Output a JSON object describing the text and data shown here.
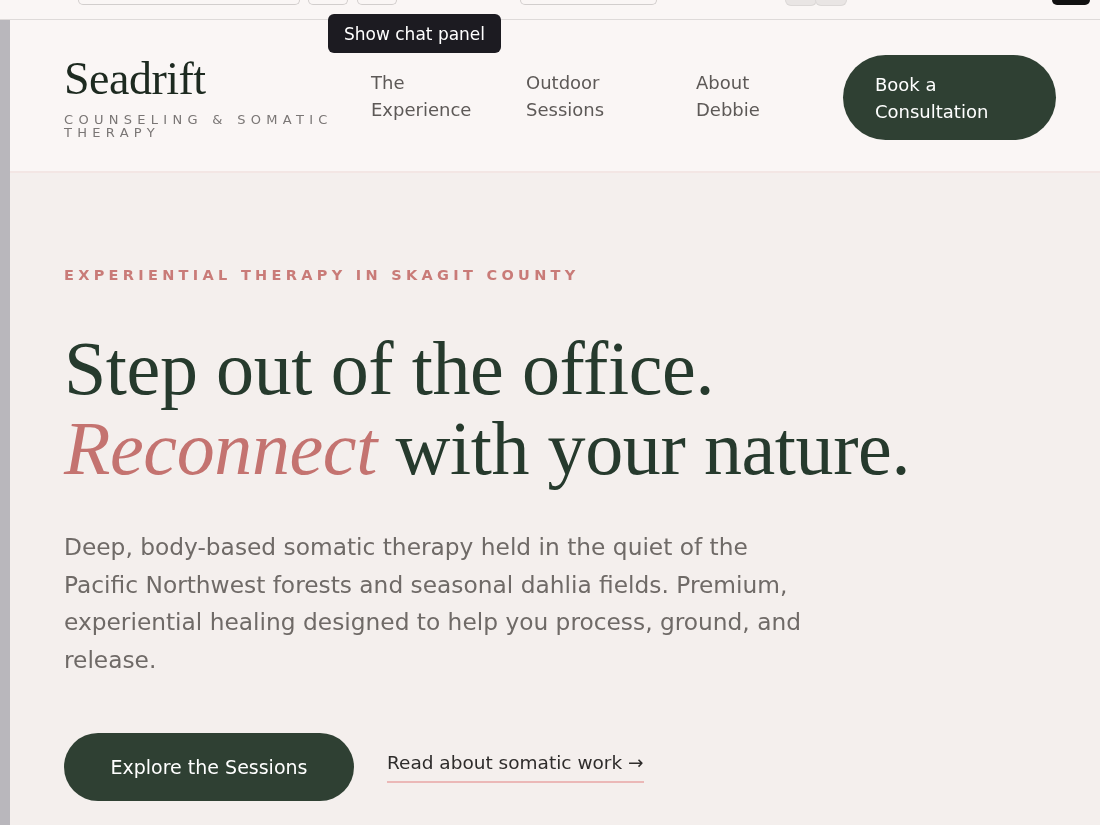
{
  "tooltip": {
    "text": "Show chat panel"
  },
  "header": {
    "logo": {
      "name": "Seadrift",
      "tagline": "COUNSELING & SOMATIC THERAPY"
    },
    "nav": [
      {
        "label": "The Experience"
      },
      {
        "label": "Outdoor Sessions"
      },
      {
        "label": "About Debbie"
      }
    ],
    "cta": "Book a Consultation"
  },
  "hero": {
    "eyebrow": "EXPERIENTIAL THERAPY IN SKAGIT COUNTY",
    "headline_lines": [
      "Step out of the office.",
      "*Reconnect* with your nature."
    ],
    "body": "Deep, body-based somatic therapy held in the quiet of the Pacific Northwest forests and seasonal dahlia fields. Premium, experiential healing designed to help you process, ground, and release.",
    "primary_button": "Explore the Sessions",
    "link": "Read about somatic work →"
  }
}
